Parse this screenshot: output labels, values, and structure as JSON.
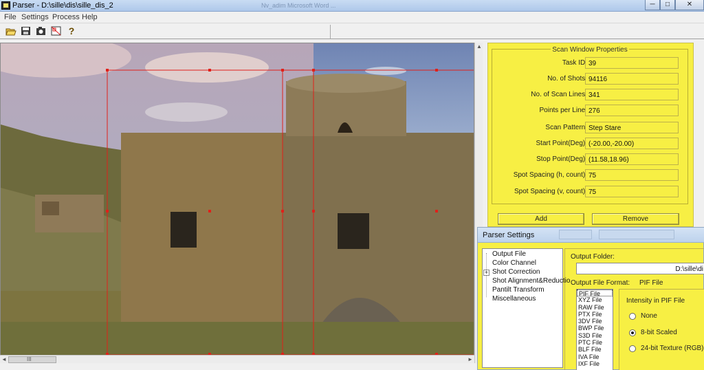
{
  "window": {
    "title": "Parser - D:\\sille\\dis\\sille_dis_2",
    "background_ghost_title": "Nv_adim   Microsoft Word ..."
  },
  "title_buttons": {
    "minimize": "─",
    "maximize": "□",
    "close": "✕"
  },
  "menu": [
    "File",
    "Settings",
    "Process",
    "Help"
  ],
  "toolbar": {
    "icons": [
      "open-folder-icon",
      "save-disk-icon",
      "camera-icon",
      "scan-grid-icon",
      "help-question-icon"
    ],
    "help_glyph": "?"
  },
  "scan_properties": {
    "title": "Scan Window Properties",
    "rows": [
      {
        "label": "Task ID:",
        "value": "39"
      },
      {
        "label": "No. of Shots:",
        "value": "94116"
      },
      {
        "label": "No. of Scan Lines:",
        "value": "341"
      },
      {
        "label": "Points per Line:",
        "value": "276"
      },
      {
        "label": "Scan Pattern:",
        "value": "Step Stare"
      },
      {
        "label": "Start Point(Deg):",
        "value": "(-20.00,-20.00)"
      },
      {
        "label": "Stop Point(Deg):",
        "value": "(11.58,18.96)"
      },
      {
        "label": "Spot Spacing (h, count):",
        "value": "75"
      },
      {
        "label": "Spot Spacing (v, count):",
        "value": "75"
      }
    ],
    "add_label": "Add",
    "remove_label": "Remove"
  },
  "parser_settings": {
    "title": "Parser Settings",
    "tree": [
      {
        "label": "Output File",
        "expander": false
      },
      {
        "label": "Color Channel",
        "expander": false
      },
      {
        "label": "Shot Correction",
        "expander": true
      },
      {
        "label": "Shot Alignment&Reductio",
        "expander": false
      },
      {
        "label": "Pantilt Transform",
        "expander": false
      },
      {
        "label": "Miscellaneous",
        "expander": false
      }
    ],
    "output_folder_label": "Output Folder:",
    "output_folder_value": "D:\\sille\\di",
    "output_format_label": "Output File Format:",
    "output_format_value": "PIF File",
    "formats": [
      "PIF File",
      "XYZ File",
      "RAW File",
      "PTX File",
      "3DV File",
      "BWP File",
      "S3D File",
      "PTC File",
      "BLF File",
      "IVA File",
      "IXF File"
    ],
    "selected_format_index": 0,
    "intensity_title": "Intensity in PIF File",
    "intensity_options": [
      "None",
      "8-bit Scaled",
      "24-bit Texture (RGB)"
    ],
    "intensity_selected": 1
  },
  "scrollbars": {
    "up": "▲",
    "down": "▼",
    "left": "◄",
    "right": "►",
    "grip": "III"
  },
  "colors": {
    "panel_yellow": "#f7ef44",
    "scan_grid_red": "#e0201a"
  }
}
